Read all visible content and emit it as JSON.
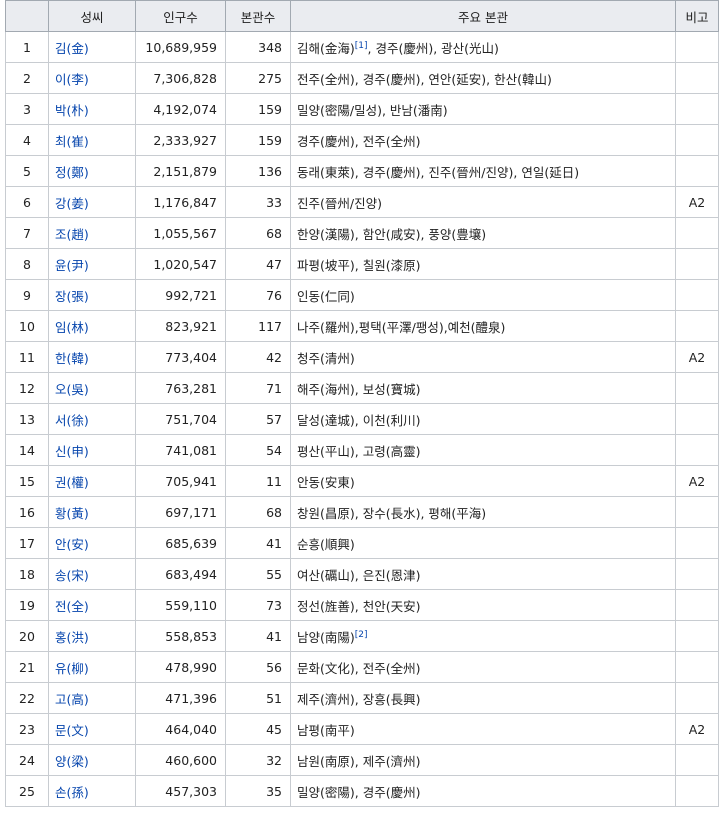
{
  "headers": {
    "rank": "",
    "surname": "성씨",
    "population": "인구수",
    "clans": "본관수",
    "main_clans": "주요 본관",
    "note": "비고"
  },
  "rows": [
    {
      "rank": "1",
      "surname": "김(金)",
      "population": "10,689,959",
      "clans": "348",
      "main": "김해(金海)",
      "ref": "[1]",
      "main_rest": ", 경주(慶州), 광산(光山)",
      "note": ""
    },
    {
      "rank": "2",
      "surname": "이(李)",
      "population": "7,306,828",
      "clans": "275",
      "main": "전주(全州), 경주(慶州), 연안(延安), 한산(韓山)",
      "ref": "",
      "main_rest": "",
      "note": ""
    },
    {
      "rank": "3",
      "surname": "박(朴)",
      "population": "4,192,074",
      "clans": "159",
      "main": "밀양(密陽/밀성), 반남(潘南)",
      "ref": "",
      "main_rest": "",
      "note": ""
    },
    {
      "rank": "4",
      "surname": "최(崔)",
      "population": "2,333,927",
      "clans": "159",
      "main": "경주(慶州), 전주(全州)",
      "ref": "",
      "main_rest": "",
      "note": ""
    },
    {
      "rank": "5",
      "surname": "정(鄭)",
      "population": "2,151,879",
      "clans": "136",
      "main": "동래(東萊), 경주(慶州), 진주(晉州/진양), 연일(延日)",
      "ref": "",
      "main_rest": "",
      "note": ""
    },
    {
      "rank": "6",
      "surname": "강(姜)",
      "population": "1,176,847",
      "clans": "33",
      "main": "진주(晉州/진양)",
      "ref": "",
      "main_rest": "",
      "note": "A2"
    },
    {
      "rank": "7",
      "surname": "조(趙)",
      "population": "1,055,567",
      "clans": "68",
      "main": "한양(漢陽), 함안(咸安), 풍양(豊壤)",
      "ref": "",
      "main_rest": "",
      "note": ""
    },
    {
      "rank": "8",
      "surname": "윤(尹)",
      "population": "1,020,547",
      "clans": "47",
      "main": "파평(坡平), 칠원(漆原)",
      "ref": "",
      "main_rest": "",
      "note": ""
    },
    {
      "rank": "9",
      "surname": "장(張)",
      "population": "992,721",
      "clans": "76",
      "main": "인동(仁同)",
      "ref": "",
      "main_rest": "",
      "note": ""
    },
    {
      "rank": "10",
      "surname": "임(林)",
      "population": "823,921",
      "clans": "117",
      "main": "나주(羅州),평택(平澤/팽성),예천(醴泉)",
      "ref": "",
      "main_rest": "",
      "note": ""
    },
    {
      "rank": "11",
      "surname": "한(韓)",
      "population": "773,404",
      "clans": "42",
      "main": "청주(清州)",
      "ref": "",
      "main_rest": "",
      "note": "A2"
    },
    {
      "rank": "12",
      "surname": "오(吳)",
      "population": "763,281",
      "clans": "71",
      "main": "해주(海州), 보성(寶城)",
      "ref": "",
      "main_rest": "",
      "note": ""
    },
    {
      "rank": "13",
      "surname": "서(徐)",
      "population": "751,704",
      "clans": "57",
      "main": "달성(達城), 이천(利川)",
      "ref": "",
      "main_rest": "",
      "note": ""
    },
    {
      "rank": "14",
      "surname": "신(申)",
      "population": "741,081",
      "clans": "54",
      "main": "평산(平山), 고령(高靈)",
      "ref": "",
      "main_rest": "",
      "note": ""
    },
    {
      "rank": "15",
      "surname": "권(權)",
      "population": "705,941",
      "clans": "11",
      "main": "안동(安東)",
      "ref": "",
      "main_rest": "",
      "note": "A2"
    },
    {
      "rank": "16",
      "surname": "황(黃)",
      "population": "697,171",
      "clans": "68",
      "main": "창원(昌原), 장수(長水), 평해(平海)",
      "ref": "",
      "main_rest": "",
      "note": ""
    },
    {
      "rank": "17",
      "surname": "안(安)",
      "population": "685,639",
      "clans": "41",
      "main": "순흥(順興)",
      "ref": "",
      "main_rest": "",
      "note": ""
    },
    {
      "rank": "18",
      "surname": "송(宋)",
      "population": "683,494",
      "clans": "55",
      "main": "여산(礪山), 은진(恩津)",
      "ref": "",
      "main_rest": "",
      "note": ""
    },
    {
      "rank": "19",
      "surname": "전(全)",
      "population": "559,110",
      "clans": "73",
      "main": "정선(旌善), 천안(天安)",
      "ref": "",
      "main_rest": "",
      "note": ""
    },
    {
      "rank": "20",
      "surname": "홍(洪)",
      "population": "558,853",
      "clans": "41",
      "main": "남양(南陽)",
      "ref": "[2]",
      "main_rest": "",
      "note": ""
    },
    {
      "rank": "21",
      "surname": "유(柳)",
      "population": "478,990",
      "clans": "56",
      "main": "문화(文化), 전주(全州)",
      "ref": "",
      "main_rest": "",
      "note": ""
    },
    {
      "rank": "22",
      "surname": "고(高)",
      "population": "471,396",
      "clans": "51",
      "main": "제주(濟州), 장흥(長興)",
      "ref": "",
      "main_rest": "",
      "note": ""
    },
    {
      "rank": "23",
      "surname": "문(文)",
      "population": "464,040",
      "clans": "45",
      "main": "남평(南平)",
      "ref": "",
      "main_rest": "",
      "note": "A2"
    },
    {
      "rank": "24",
      "surname": "양(梁)",
      "population": "460,600",
      "clans": "32",
      "main": "남원(南原), 제주(濟州)",
      "ref": "",
      "main_rest": "",
      "note": ""
    },
    {
      "rank": "25",
      "surname": "손(孫)",
      "population": "457,303",
      "clans": "35",
      "main": "밀양(密陽), 경주(慶州)",
      "ref": "",
      "main_rest": "",
      "note": ""
    }
  ]
}
